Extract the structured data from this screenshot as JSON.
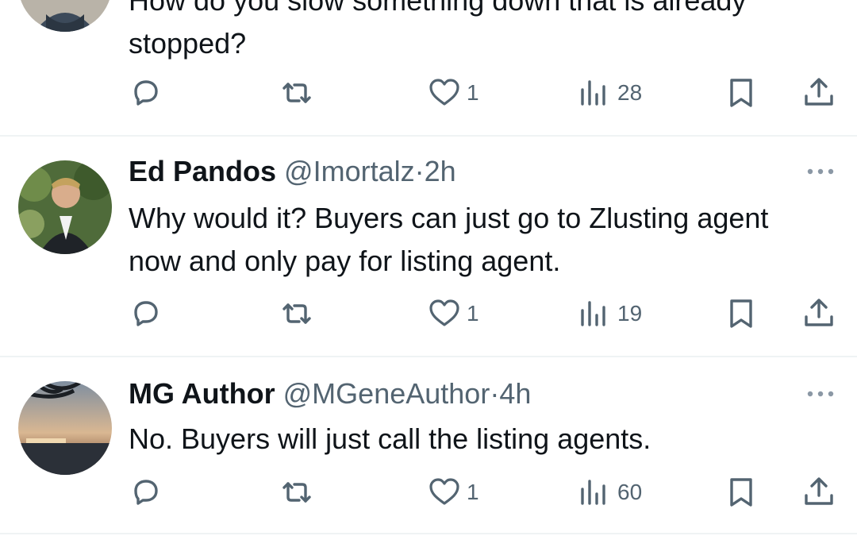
{
  "tweets": [
    {
      "name": "",
      "handle": "",
      "time": "",
      "text": "How do you slow something down that is already stopped?",
      "actions": {
        "reply_count": "",
        "retweet_count": "",
        "like_count": "1",
        "view_count": "28"
      }
    },
    {
      "name": "Ed Pandos",
      "handle": "@Imortalz",
      "dot": "·",
      "time": "2h",
      "text": "Why would it?  Buyers can just go to Zlusting agent now and only pay for listing agent.",
      "actions": {
        "reply_count": "",
        "retweet_count": "",
        "like_count": "1",
        "view_count": "19"
      }
    },
    {
      "name": "MG Author",
      "handle": "@MGeneAuthor",
      "dot": "·",
      "time": "4h",
      "text": "No. Buyers will just call the listing agents.",
      "actions": {
        "reply_count": "",
        "retweet_count": "",
        "like_count": "1",
        "view_count": "60"
      }
    }
  ],
  "icons": {
    "reply": "reply-icon",
    "retweet": "retweet-icon",
    "like": "heart-icon",
    "views": "views-icon",
    "bookmark": "bookmark-icon",
    "share": "share-icon",
    "more": "more-icon"
  },
  "colors": {
    "text": "#0f1419",
    "secondary": "#536471",
    "divider": "#eff3f4"
  }
}
